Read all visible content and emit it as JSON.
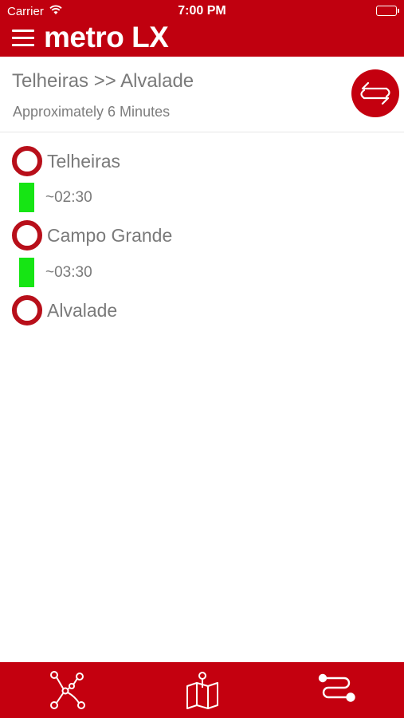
{
  "status_bar": {
    "carrier": "Carrier",
    "time": "7:00 PM"
  },
  "nav": {
    "logo_text": "metro LX",
    "menu_icon": "hamburger-icon"
  },
  "route": {
    "title": "Telheiras >> Alvalade",
    "duration": "Approximately 6 Minutes",
    "swap_icon": "swap-direction-icon"
  },
  "stops": [
    {
      "name": "Telheiras"
    },
    {
      "name": "Campo Grande"
    },
    {
      "name": "Alvalade"
    }
  ],
  "segments": [
    {
      "duration": "~02:30",
      "line_color": "#16e514"
    },
    {
      "duration": "~03:30",
      "line_color": "#16e514"
    }
  ],
  "tabs": [
    {
      "icon": "network-icon"
    },
    {
      "icon": "map-icon"
    },
    {
      "icon": "route-icon"
    }
  ],
  "colors": {
    "brand_red": "#c4000f",
    "stop_ring": "#b80f1a",
    "line_green": "#16e514"
  }
}
